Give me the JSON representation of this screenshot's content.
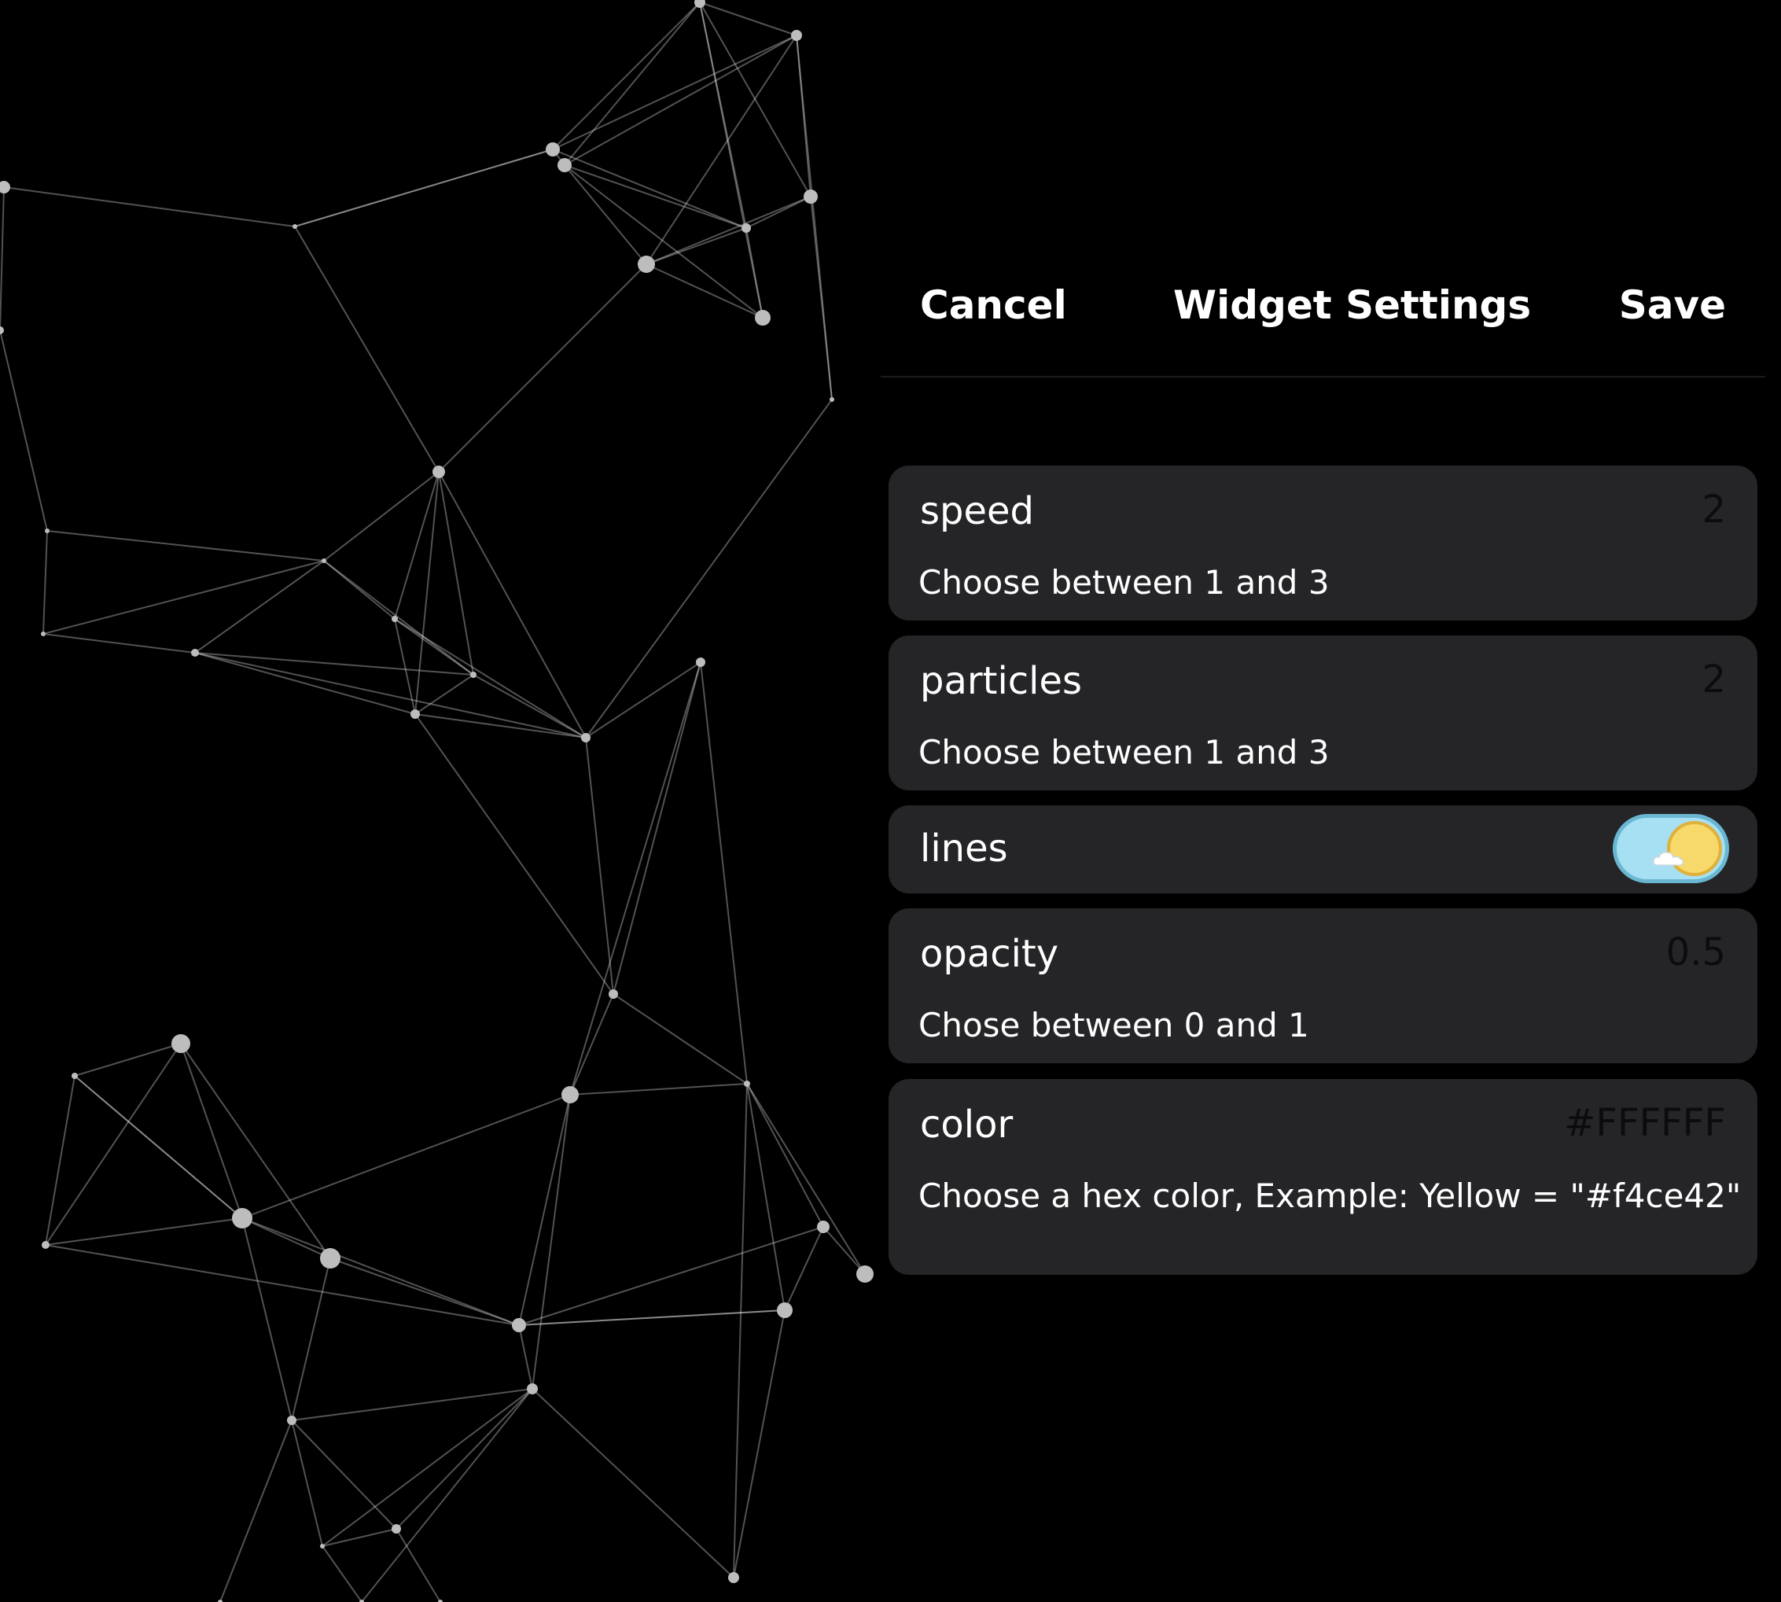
{
  "nav": {
    "cancel_label": "Cancel",
    "title": "Widget Settings",
    "save_label": "Save"
  },
  "settings": [
    {
      "name": "speed",
      "value": "2",
      "hint": "Choose between 1 and 3"
    },
    {
      "name": "particles",
      "value": "2",
      "hint": "Choose between 1 and 3"
    },
    {
      "name": "lines",
      "toggle_on": true
    },
    {
      "name": "opacity",
      "value": "0.5",
      "hint": "Chose between 0 and 1"
    },
    {
      "name": "color",
      "value": "#FFFFFF",
      "hint": "Choose a hex color, Example: Yellow = \"#f4ce42\""
    }
  ],
  "toggle_icons": [
    "sun-icon",
    "cloud-icon"
  ],
  "colors": {
    "background": "#000000",
    "card": "#252528",
    "text": "#FFFFFF",
    "toggle_track": "#A8E0F3",
    "toggle_sun": "#F7D86A"
  }
}
